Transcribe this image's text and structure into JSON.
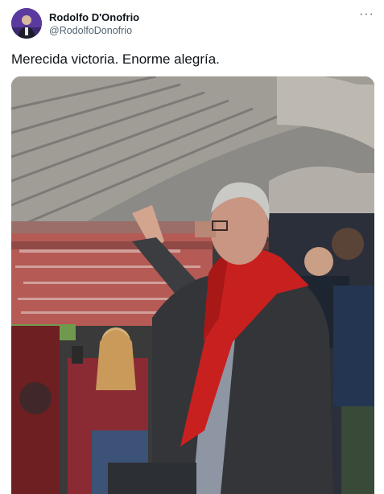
{
  "tweet": {
    "author_name": "Rodolfo D'Onofrio",
    "author_handle": "@RodolfoDonofrio",
    "text": "Merecida victoria. Enorme alegría.",
    "more_glyph": "···"
  },
  "icons": {
    "more": "more-options-icon",
    "avatar": "profile-avatar"
  },
  "colors": {
    "primary_text": "#0f1419",
    "secondary_text": "#536471",
    "scarf_red": "#c8201f"
  }
}
